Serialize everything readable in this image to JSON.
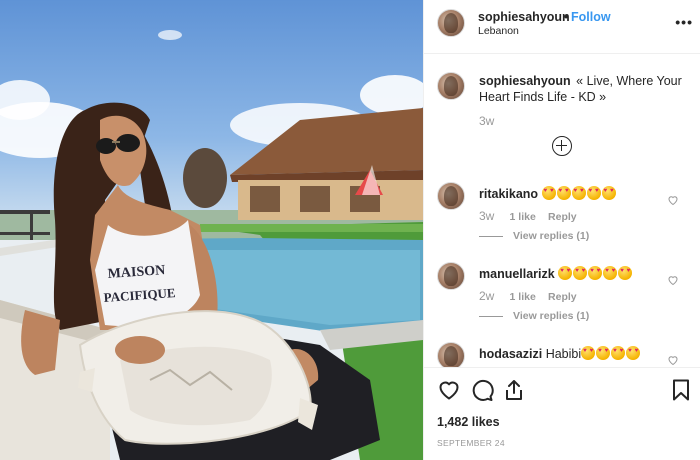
{
  "header": {
    "username": "sophiesahyoun",
    "separator": "•",
    "follow_label": "Follow",
    "location": "Lebanon",
    "more_label": "•••"
  },
  "photo": {
    "shirt_text_line1": "MAISON",
    "shirt_text_line2": "PACIFIQUE"
  },
  "caption": {
    "username": "sophiesahyoun",
    "text": "« Live, Where Your Heart Finds Life - KD »",
    "time": "3w"
  },
  "comments": [
    {
      "username": "ritakikano",
      "text": "",
      "emoji_count": 5,
      "time": "3w",
      "likes": "1 like",
      "reply": "Reply",
      "view_replies": "View replies (1)"
    },
    {
      "username": "manuellarizk",
      "text": "",
      "emoji_count": 5,
      "time": "2w",
      "likes": "1 like",
      "reply": "Reply",
      "view_replies": "View replies (1)"
    },
    {
      "username": "hodasazizi",
      "text": "Habibi",
      "emoji_count": 4
    }
  ],
  "footer": {
    "likes": "1,482 likes",
    "date": "SEPTEMBER 24"
  },
  "colors": {
    "accent": "#3897f0",
    "text": "#262626",
    "muted": "#999999",
    "border": "#efefef"
  },
  "icons": [
    "heart-icon",
    "comment-icon",
    "share-icon",
    "bookmark-icon",
    "more-icon",
    "plus-circle-icon",
    "emoji-heart-eyes-icon"
  ]
}
